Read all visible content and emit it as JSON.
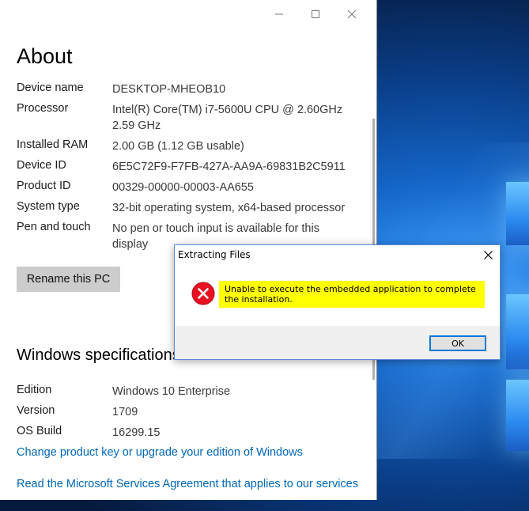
{
  "about": {
    "heading": "About",
    "device_specs": [
      {
        "label": "Device name",
        "value": "DESKTOP-MHEOB10"
      },
      {
        "label": "Processor",
        "value": "Intel(R) Core(TM) i7-5600U CPU @ 2.60GHz 2.59 GHz"
      },
      {
        "label": "Installed RAM",
        "value": "2.00 GB (1.12 GB usable)"
      },
      {
        "label": "Device ID",
        "value": "6E5C72F9-F7FB-427A-AA9A-69831B2C5911"
      },
      {
        "label": "Product ID",
        "value": "00329-00000-00003-AA655"
      },
      {
        "label": "System type",
        "value": "32-bit operating system, x64-based processor"
      },
      {
        "label": "Pen and touch",
        "value": "No pen or touch input is available for this display"
      }
    ],
    "rename_button": "Rename this PC",
    "windows_specs_heading": "Windows specifications",
    "windows_specs": [
      {
        "label": "Edition",
        "value": "Windows 10 Enterprise"
      },
      {
        "label": "Version",
        "value": "1709"
      },
      {
        "label": "OS Build",
        "value": "16299.15"
      }
    ],
    "change_key_link": "Change product key or upgrade your edition of Windows",
    "msa_link": "Read the Microsoft Services Agreement that applies to our services"
  },
  "window_controls": {
    "minimize": "minimize-icon",
    "maximize": "maximize-icon",
    "close": "close-icon"
  },
  "dialog": {
    "title": "Extracting Files",
    "message": "Unable to execute the embedded application to complete the installation.",
    "ok_label": "OK",
    "icon": "error-icon",
    "highlight_color": "#ffff00"
  },
  "colors": {
    "link": "#0067b8",
    "error_red": "#e81123",
    "accent": "#0078d7"
  }
}
